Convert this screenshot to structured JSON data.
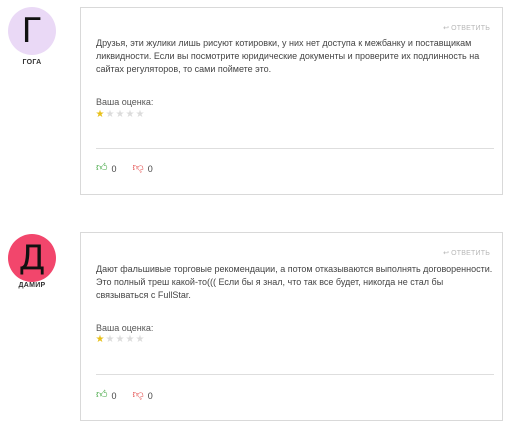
{
  "reply_label": "ОТВЕТИТЬ",
  "reply_icon": "reply-arrow-icon",
  "rating_label": "Ваша оценка:",
  "colors": {
    "star_active": "#e8c01a",
    "star_inactive": "#dcdcdc",
    "thumb_up": "#3aa33a",
    "thumb_down": "#e24646"
  },
  "reviews": [
    {
      "avatar_letter": "Г",
      "avatar_bg": "#ead9f6",
      "avatar_color": "#111111",
      "username": "ГОГА",
      "text": "Друзья, эти жулики лишь рисуют котировки, у них нет доступа к межбанку и поставщикам ликвидности. Если вы посмотрите юридические документы и проверите их подлинность на сайтах регуляторов, то сами поймете это.",
      "rating": 1,
      "rating_max": 5,
      "likes": "0",
      "dislikes": "0"
    },
    {
      "avatar_letter": "Д",
      "avatar_bg": "#f2466c",
      "avatar_color": "#111111",
      "username": "ДАМИР",
      "text": "Дают фальшивые торговые рекомендации, а потом отказываются выполнять договоренности. Это полный треш какой-то((( Если бы я знал, что так все будет, никогда не стал бы связываться с FullStar.",
      "rating": 1,
      "rating_max": 5,
      "likes": "0",
      "dislikes": "0"
    }
  ]
}
